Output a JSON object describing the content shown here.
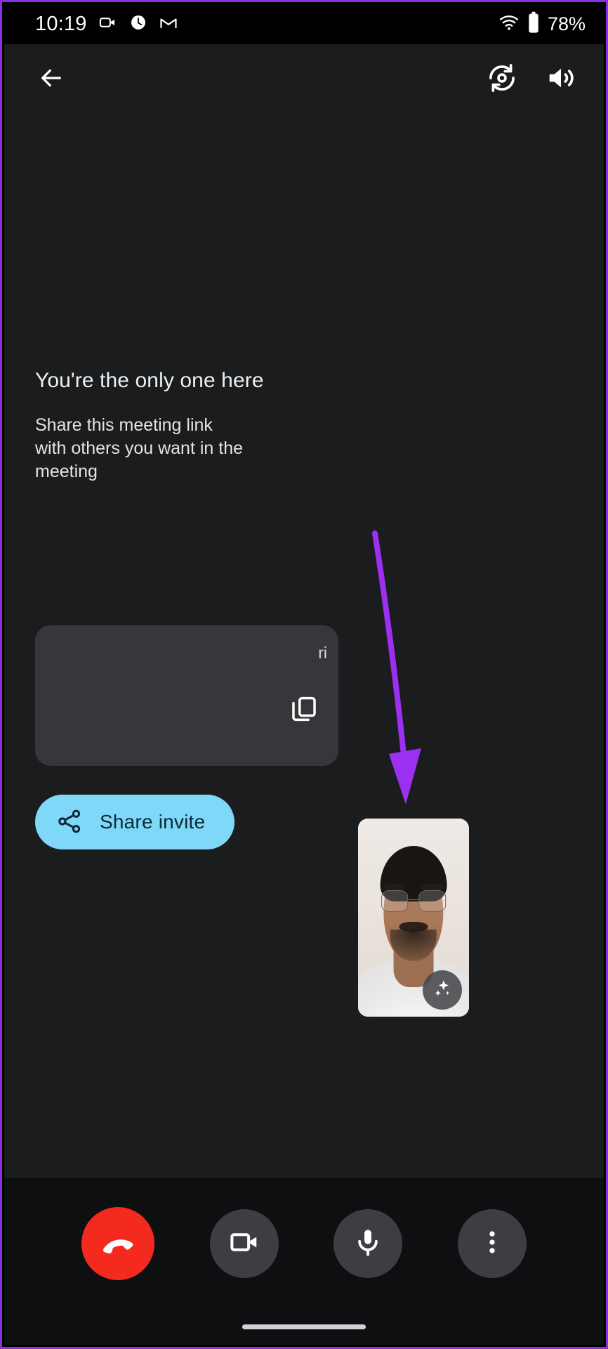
{
  "status_bar": {
    "time": "10:19",
    "battery_percent": "78%",
    "icons": [
      "video-camera-icon",
      "clock-circle-icon",
      "gmail-icon",
      "wifi-icon",
      "battery-icon"
    ]
  },
  "app_bar": {
    "back_label": "Back",
    "meeting_title": "",
    "switch_camera_label": "Switch camera",
    "speaker_label": "Speaker"
  },
  "stage": {
    "headline": "You're the only one here",
    "subline": "Share this meeting link\nwith others you want in the\nmeeting",
    "link_card": {
      "meeting_link": "",
      "link_trailing_visible": "ri",
      "copy_label": "Copy link"
    },
    "share_invite": {
      "label": "Share invite",
      "icon": "share-icon"
    },
    "self_view": {
      "effects_label": "Apply visual effects",
      "effects_icon": "sparkles-icon"
    }
  },
  "controls": [
    {
      "name": "leave-call",
      "label": "Leave call",
      "icon": "phone-hangup-icon",
      "style": "danger"
    },
    {
      "name": "camera-toggle",
      "label": "Turn off camera",
      "icon": "video-camera-icon",
      "style": "neutral"
    },
    {
      "name": "mic-toggle",
      "label": "Mute microphone",
      "icon": "microphone-icon",
      "style": "neutral"
    },
    {
      "name": "more-options",
      "label": "More options",
      "icon": "more-vertical-icon",
      "style": "neutral"
    }
  ],
  "colors": {
    "accent_button": "#7fd8f7",
    "accent_button_text": "#0b2a38",
    "danger": "#f52a1f",
    "surface": "#1b1c1e",
    "control_bar": "#0e0f11",
    "card": "#35373a",
    "annotation_arrow": "#9b30f0"
  },
  "annotation": {
    "arrow_color": "#9b30f0",
    "points_to": "self-view-thumbnail"
  }
}
